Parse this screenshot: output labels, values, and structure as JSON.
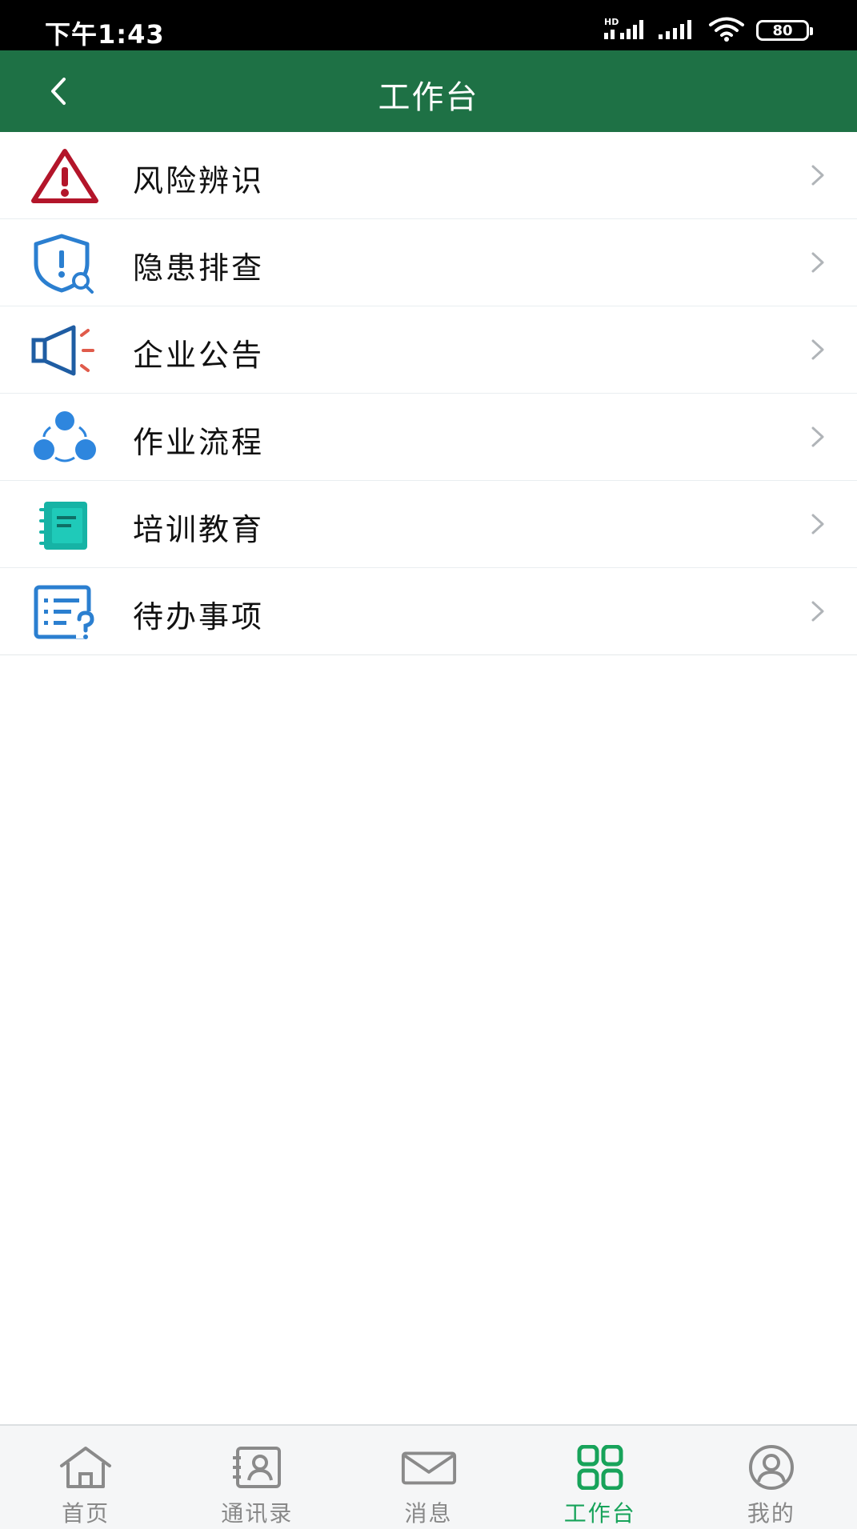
{
  "status_bar": {
    "time": "下午1:43",
    "battery": "80",
    "hd_label": "HD"
  },
  "header": {
    "title": "工作台",
    "back_icon": "chevron-left-icon"
  },
  "menu": [
    {
      "label": "风险辨识",
      "icon": "warning-triangle-icon"
    },
    {
      "label": "隐患排查",
      "icon": "shield-search-icon"
    },
    {
      "label": "企业公告",
      "icon": "megaphone-icon"
    },
    {
      "label": "作业流程",
      "icon": "process-nodes-icon"
    },
    {
      "label": "培训教育",
      "icon": "notebook-icon"
    },
    {
      "label": "待办事项",
      "icon": "todo-list-icon"
    }
  ],
  "tabbar": {
    "items": [
      {
        "label": "首页",
        "icon": "home-icon",
        "active": false
      },
      {
        "label": "通讯录",
        "icon": "contacts-icon",
        "active": false
      },
      {
        "label": "消息",
        "icon": "mail-icon",
        "active": false
      },
      {
        "label": "工作台",
        "icon": "grid-icon",
        "active": true
      },
      {
        "label": "我的",
        "icon": "user-icon",
        "active": false
      }
    ]
  },
  "colors": {
    "header_bg": "#1e7145",
    "active_tab": "#17a35a",
    "inactive_tab": "#888888"
  }
}
